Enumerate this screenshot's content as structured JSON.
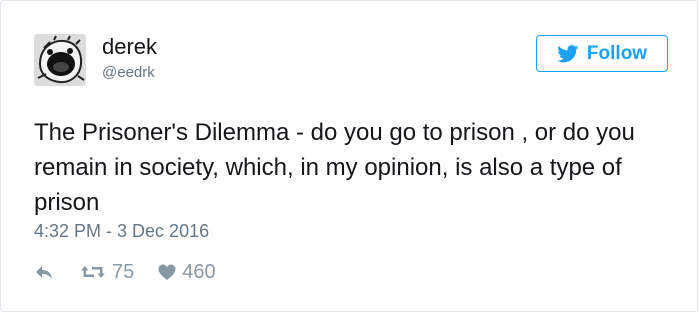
{
  "author": {
    "name": "derek",
    "handle": "@eedrk"
  },
  "follow_button": {
    "label": "Follow"
  },
  "tweet": {
    "text": "The Prisoner's Dilemma - do you go to prison , or do you remain in society, which, in my opinion, is also a type of prison",
    "timestamp": "4:32 PM - 3 Dec 2016"
  },
  "actions": {
    "retweets": "75",
    "likes": "460"
  },
  "colors": {
    "accent": "#1da1f2",
    "text": "#14171a",
    "secondary": "#657786",
    "icon": "#8899a6"
  },
  "icons": {
    "avatar": "screaming-face-avatar",
    "follow": "twitter-bird-icon",
    "reply": "reply-icon",
    "retweet": "retweet-icon",
    "like": "heart-icon"
  }
}
